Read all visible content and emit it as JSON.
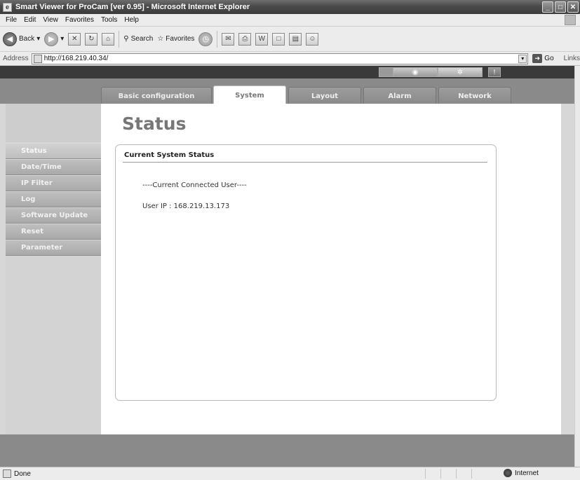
{
  "window": {
    "title": "Smart Viewer for ProCam [ver 0.95] - Microsoft Internet Explorer",
    "minimize": "_",
    "maximize": "□",
    "close": "✕"
  },
  "menu": [
    "File",
    "Edit",
    "View",
    "Favorites",
    "Tools",
    "Help"
  ],
  "toolbar": {
    "back": "Back",
    "search": "Search",
    "favorites": "Favorites"
  },
  "address": {
    "label": "Address",
    "url": "http://168.219.40.34/",
    "go": "Go",
    "links": "Links"
  },
  "tabs": [
    "Basic configuration",
    "System",
    "Layout",
    "Alarm",
    "Network"
  ],
  "sidebar": {
    "items": [
      "Status",
      "Date/Time",
      "IP Filter",
      "Log",
      "Software Update",
      "Reset",
      "Parameter"
    ]
  },
  "page": {
    "title": "Status",
    "section_heading": "Current System Status",
    "connected_header": "----Current Connected User----",
    "user_ip": "User IP : 168.219.13.173"
  },
  "status": {
    "left": "Done",
    "zone": "Internet"
  }
}
